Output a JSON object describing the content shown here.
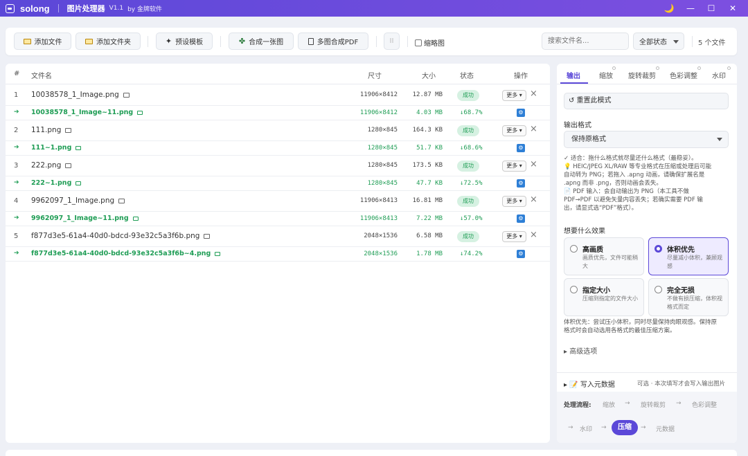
{
  "titlebar": {
    "brand": "solong",
    "title": "图片处理器",
    "version": "V1.1",
    "by": "by 金牌软件"
  },
  "window_controls": {
    "theme": "🌙",
    "minimize": "—",
    "maximize": "☐",
    "close": "✕"
  },
  "toolbar": {
    "add_file": "添加文件",
    "add_folder": "添加文件夹",
    "presets": "预设模板",
    "merge_one": "合成一张图",
    "merge_pdf": "多图合成PDF",
    "pause": "II",
    "thumbnail": "缩略图",
    "search_placeholder": "搜索文件名...",
    "status_filter": "全部状态",
    "file_count": "5 个文件"
  },
  "list": {
    "headers": {
      "index": "#",
      "name": "文件名",
      "dims": "尺寸",
      "size": "大小",
      "status": "状态",
      "action": "操作"
    },
    "files": [
      {
        "index": "1",
        "name": "10038578_1_Image.png",
        "dims": "11906×8412",
        "size": "12.87 MB",
        "status": "成功",
        "more": "更多 ▾",
        "out_name": "10038578_1_Image~11.png",
        "out_dims": "11906×8412",
        "out_size": "4.03 MB",
        "out_pct": "↓68.7%"
      },
      {
        "index": "2",
        "name": "111.png",
        "dims": "1280×845",
        "size": "164.3 KB",
        "status": "成功",
        "more": "更多 ▾",
        "out_name": "111~1.png",
        "out_dims": "1280×845",
        "out_size": "51.7 KB",
        "out_pct": "↓68.6%"
      },
      {
        "index": "3",
        "name": "222.png",
        "dims": "1280×845",
        "size": "173.5 KB",
        "status": "成功",
        "more": "更多 ▾",
        "out_name": "222~1.png",
        "out_dims": "1280×845",
        "out_size": "47.7 KB",
        "out_pct": "↓72.5%"
      },
      {
        "index": "4",
        "name": "9962097_1_Image.png",
        "dims": "11906×8413",
        "size": "16.81 MB",
        "status": "成功",
        "more": "更多 ▾",
        "out_name": "9962097_1_Image~11.png",
        "out_dims": "11906×8413",
        "out_size": "7.22 MB",
        "out_pct": "↓57.0%"
      },
      {
        "index": "5",
        "name": "f877d3e5-61a4-40d0-bdcd-93e32c5a3f6b.png",
        "dims": "2048×1536",
        "size": "6.58 MB",
        "status": "成功",
        "more": "更多 ▾",
        "out_name": "f877d3e5-61a4-40d0-bdcd-93e32c5a3f6b~4.png",
        "out_dims": "2048×1536",
        "out_size": "1.78 MB",
        "out_pct": "↓74.2%"
      }
    ]
  },
  "panel": {
    "tabs": [
      "输出",
      "缩放",
      "旋转裁剪",
      "色彩调整",
      "水印"
    ],
    "reset": "↺ 重置此模式",
    "output_format_label": "输出格式",
    "output_format_value": "保持原格式",
    "hint_lines": [
      "✓ 适合：拖什么格式就尽量还什么格式（最稳妥）。",
      "💡 HEIC/JPEG XL/RAW 等专业格式在压缩或处理后可能",
      "自动转为 PNG；若拖入 .apng 动画，请确保扩展名是",
      ".apng 而非 .png，否则动画会丢失。",
      "📄 PDF 输入：会自动输出为 PNG（本工具不做",
      "PDF→PDF 以避免矢量内容丢失；若确实需要 PDF 输",
      "出，请显式选“PDF”格式）。"
    ],
    "effect_label": "想要什么效果",
    "options": [
      {
        "title": "高画质",
        "desc": "画质优先，文件可能稍大"
      },
      {
        "title": "体积优先",
        "desc": "尽量减小体积，兼顾观感"
      },
      {
        "title": "指定大小",
        "desc": "压缩到指定的文件大小"
      },
      {
        "title": "完全无损",
        "desc": "不做有损压缩，体积视格式而定"
      }
    ],
    "effect_note_lines": [
      "体积优先：尝试压小体积，同时尽量保持肉眼观感。保持原",
      "格式时会自动选用各格式的最佳压缩方案。"
    ],
    "advanced": "▸ 高级选项",
    "metadata": "▸ 📝 写入元数据",
    "metadata_note": "可选 · 本次填写才会写入输出图片",
    "flow": {
      "label": "处理流程:",
      "scale": "缩放",
      "rotate": "旋转裁剪",
      "color": "色彩调整",
      "watermark": "水印",
      "compress": "压缩",
      "metadata": "元数据",
      "arrow": "→"
    }
  },
  "colors": {
    "accent": "#5b48d8",
    "success": "#1f9d55",
    "badge_bg": "#d6f1e2",
    "titlebar": "#6a4ddd"
  },
  "icons": {
    "folder": "folder-icon",
    "presets": "wand-icon",
    "merge": "puzzle-icon",
    "pdf": "document-icon",
    "settings": "gear-icon"
  }
}
